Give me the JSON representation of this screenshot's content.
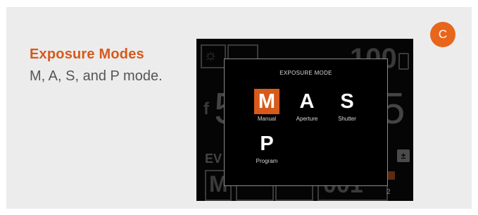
{
  "badge": "C",
  "title": "Exposure Modes",
  "subtitle": "M, A, S, and P mode.",
  "dialog": {
    "title": "EXPOSURE MODE",
    "modes": [
      {
        "letter": "M",
        "label": "Manual",
        "selected": true
      },
      {
        "letter": "A",
        "label": "Aperture",
        "selected": false
      },
      {
        "letter": "S",
        "label": "Shutter",
        "selected": false
      },
      {
        "letter": "P",
        "label": "Program",
        "selected": false
      }
    ]
  },
  "background": {
    "top_number": "100",
    "aperture_prefix": "f",
    "big_digit_left": "5",
    "big_digit_right": "5",
    "ev_label": "EV",
    "mode_letter": "M",
    "shot_count": "001",
    "small_index": "2",
    "exposure_comp_digit": "0"
  },
  "colors": {
    "accent": "#d75a1a",
    "badge": "#e8651c",
    "title": "#d6591b",
    "card": "#ececec"
  }
}
